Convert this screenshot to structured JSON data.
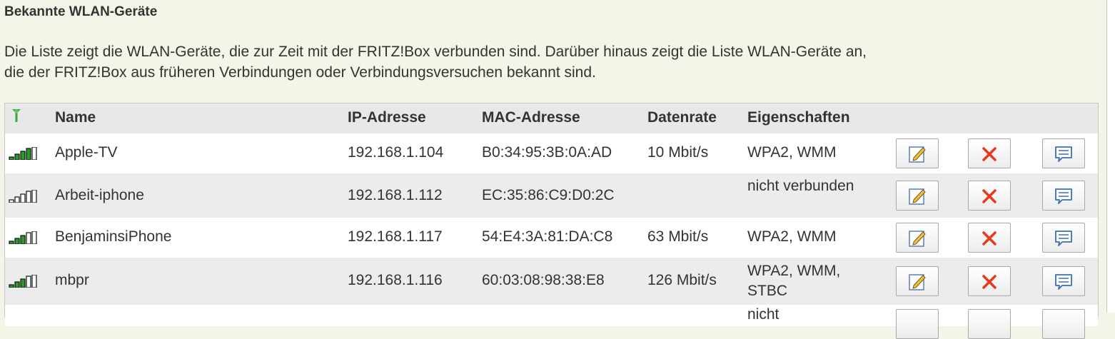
{
  "title": "Bekannte WLAN-Geräte",
  "description": {
    "line1": "Die Liste zeigt die WLAN-Geräte, die zur Zeit mit der FRITZ!Box verbunden sind. Darüber hinaus zeigt die Liste WLAN-Geräte an,",
    "line2": "die der FRITZ!Box aus früheren Verbindungen oder Verbindungsversuchen bekannt sind."
  },
  "table": {
    "headers": {
      "signal_icon": "antenna-icon",
      "name": "Name",
      "ip": "IP-Adresse",
      "mac": "MAC-Adresse",
      "rate": "Datenrate",
      "props": "Eigenschaften"
    },
    "rows": [
      {
        "name": "Apple-TV",
        "ip": "192.168.1.104",
        "mac": "B0:34:95:3B:0A:AD",
        "rate": "10 Mbit/s",
        "props": "WPA2, WMM",
        "signal_level": 4
      },
      {
        "name": "Arbeit-iphone",
        "ip": "192.168.1.112",
        "mac": "EC:35:86:C9:D0:2C",
        "rate": "",
        "props": "nicht verbunden",
        "signal_level": 0
      },
      {
        "name": "BenjaminsiPhone",
        "ip": "192.168.1.117",
        "mac": "54:E4:3A:81:DA:C8",
        "rate": "63 Mbit/s",
        "props": "WPA2, WMM",
        "signal_level": 3
      },
      {
        "name": "mbpr",
        "ip": "192.168.1.116",
        "mac": "60:03:08:98:38:E8",
        "rate": "126 Mbit/s",
        "props": "WPA2, WMM, STBC",
        "signal_level": 3
      },
      {
        "name": "",
        "ip": "",
        "mac": "",
        "rate": "",
        "props": "nicht",
        "signal_level": 0
      }
    ],
    "actions": {
      "edit_icon": "edit-icon",
      "delete_icon": "delete-icon",
      "info_icon": "message-icon"
    }
  },
  "colors": {
    "signal_active": "#2a9a2a",
    "signal_inactive": "#222222",
    "delete_red": "#e83a1a",
    "header_bg": "#e8e8e8",
    "page_bg": "#f4f4e8"
  }
}
